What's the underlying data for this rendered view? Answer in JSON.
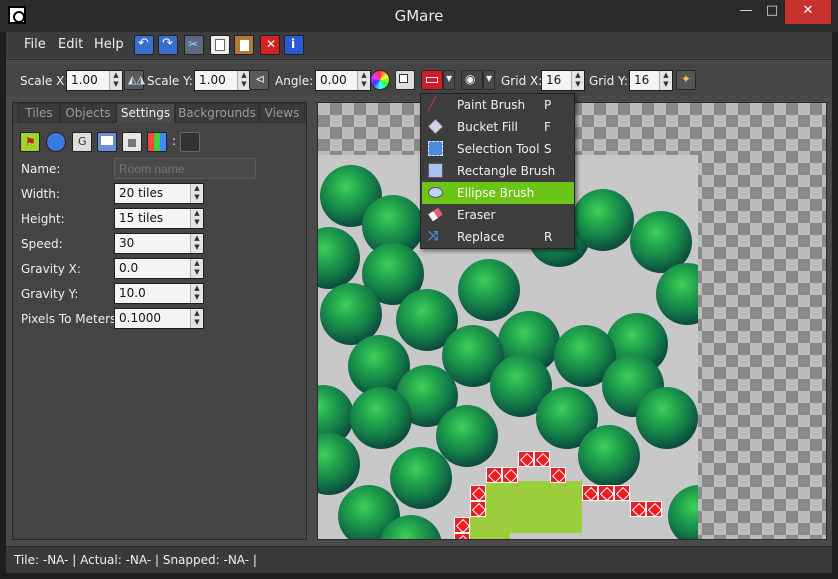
{
  "window": {
    "title": "GMare",
    "minimize": "—",
    "maximize": "□",
    "close": "✕"
  },
  "menu": {
    "items": [
      "File",
      "Edit",
      "Help"
    ]
  },
  "toolbar": {
    "scale_x_label": "Scale X:",
    "scale_x_value": "1.00",
    "scale_y_label": "Scale Y:",
    "scale_y_value": "1.00",
    "angle_label": "Angle:",
    "angle_value": "0.00",
    "grid_x_label": "Grid X:",
    "grid_x_value": "16",
    "grid_y_label": "Grid Y:",
    "grid_y_value": "16"
  },
  "tabs": [
    {
      "label": "Tiles",
      "active": false
    },
    {
      "label": "Objects",
      "active": false
    },
    {
      "label": "Settings",
      "active": true
    },
    {
      "label": "Backgrounds",
      "active": false
    },
    {
      "label": "Views",
      "active": false
    }
  ],
  "settings": {
    "icon_separator": ":",
    "name_label": "Name:",
    "name_placeholder": "Room name",
    "width_label": "Width:",
    "width_value": "20 tiles",
    "height_label": "Height:",
    "height_value": "15 tiles",
    "speed_label": "Speed:",
    "speed_value": "30",
    "gravity_x_label": "Gravity X:",
    "gravity_x_value": "0.0",
    "gravity_y_label": "Gravity Y:",
    "gravity_y_value": "10.0",
    "ppm_label": "Pixels To Meters:",
    "ppm_value": "0.1000"
  },
  "brush_menu": {
    "items": [
      {
        "label": "Paint Brush",
        "key": "P",
        "icon": "paint-brush-icon"
      },
      {
        "label": "Bucket Fill",
        "key": "F",
        "icon": "bucket-fill-icon"
      },
      {
        "label": "Selection Tool",
        "key": "S",
        "icon": "selection-tool-icon"
      },
      {
        "label": "Rectangle Brush",
        "key": "",
        "icon": "rectangle-brush-icon"
      },
      {
        "label": "Ellipse Brush",
        "key": "",
        "icon": "ellipse-brush-icon",
        "highlighted": true
      },
      {
        "label": "Eraser",
        "key": "",
        "icon": "eraser-icon"
      },
      {
        "label": "Replace",
        "key": "R",
        "icon": "replace-icon"
      }
    ]
  },
  "status": {
    "text": "Tile: -NA- | Actual: -NA- | Snapped: -NA- |"
  },
  "colors": {
    "accent": "#6cc414",
    "close": "#c7322f",
    "tree": "#20a24c",
    "red_tile": "#ef1c24"
  }
}
